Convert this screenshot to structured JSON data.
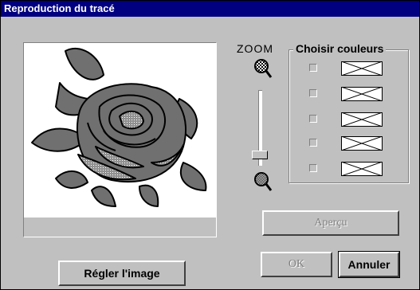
{
  "window": {
    "title": "Reproduction du tracé"
  },
  "zoom": {
    "label": "ZOOM",
    "in_icon": "zoom-in-icon",
    "out_icon": "zoom-out-icon"
  },
  "colors_group": {
    "title": "Choisir couleurs",
    "rows": [
      {
        "checked": false
      },
      {
        "checked": false
      },
      {
        "checked": false
      },
      {
        "checked": false
      },
      {
        "checked": false
      }
    ]
  },
  "buttons": {
    "apercu": "Aperçu",
    "ok": "OK",
    "annuler": "Annuler",
    "regler": "Régler l'image"
  },
  "colors": {
    "title_bar": "#000080",
    "face": "#c0c0c0",
    "rose_fill": "#707070"
  }
}
